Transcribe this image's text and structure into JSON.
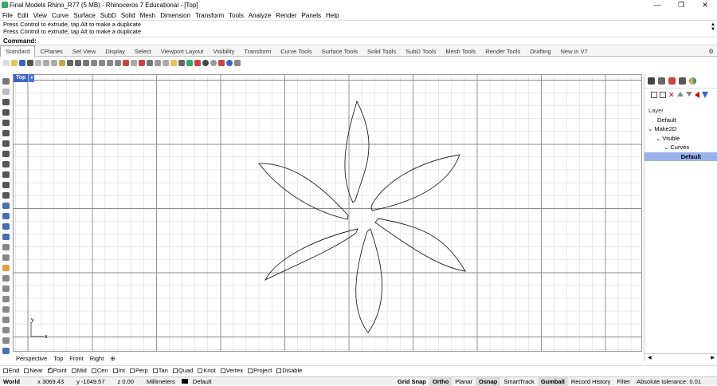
{
  "window": {
    "title": "Final Models Rhino_R77 (5 MB) - Rhinoceros 7 Educational - [Top]",
    "min": "—",
    "restore": "❐",
    "close": "✕"
  },
  "menu": [
    "File",
    "Edit",
    "View",
    "Curve",
    "Surface",
    "SubD",
    "Solid",
    "Mesh",
    "Dimension",
    "Transform",
    "Tools",
    "Analyze",
    "Render",
    "Panels",
    "Help"
  ],
  "command": {
    "history": [
      "Press Control to extrude, tap Alt to make a duplicate",
      "Press Control to extrude, tap Alt to make a duplicate"
    ],
    "prompt": "Command:"
  },
  "tabs": {
    "items": [
      "Standard",
      "CPlanes",
      "Set View",
      "Display",
      "Select",
      "Viewport Layout",
      "Visibility",
      "Transform",
      "Curve Tools",
      "Surface Tools",
      "Solid Tools",
      "SubD Tools",
      "Mesh Tools",
      "Render Tools",
      "Drafting",
      "New in V7"
    ],
    "active": 0
  },
  "viewport": {
    "name": "Top",
    "axis_x": "x",
    "axis_y": "y"
  },
  "layers": {
    "header": "Layer",
    "items": [
      {
        "label": "Default",
        "indent": 0,
        "expander": ""
      },
      {
        "label": "Make2D",
        "indent": 0,
        "expander": "⌄"
      },
      {
        "label": "Visible",
        "indent": 1,
        "expander": "⌄"
      },
      {
        "label": "Curves",
        "indent": 2,
        "expander": "⌄"
      },
      {
        "label": "Default",
        "indent": 3,
        "expander": "",
        "selected": true
      }
    ]
  },
  "view_tabs": [
    "Perspective",
    "Top",
    "Front",
    "Right",
    "⊕"
  ],
  "osnaps": [
    {
      "label": "End",
      "on": false
    },
    {
      "label": "Near",
      "on": false
    },
    {
      "label": "Point",
      "on": true
    },
    {
      "label": "Mid",
      "on": false
    },
    {
      "label": "Cen",
      "on": false
    },
    {
      "label": "Int",
      "on": false
    },
    {
      "label": "Perp",
      "on": false
    },
    {
      "label": "Tan",
      "on": false
    },
    {
      "label": "Quad",
      "on": false
    },
    {
      "label": "Knot",
      "on": false
    },
    {
      "label": "Vertex",
      "on": false
    },
    {
      "label": "Project",
      "on": false
    },
    {
      "label": "Disable",
      "on": false
    }
  ],
  "status": {
    "cplane": "World",
    "x": "x 3069.43",
    "y": "y -1049.57",
    "z": "z 0.00",
    "units": "Millimeters",
    "layer": "Default",
    "toggles": [
      {
        "label": "Grid Snap",
        "on": true
      },
      {
        "label": "Ortho",
        "on": true
      },
      {
        "label": "Planar",
        "on": false
      },
      {
        "label": "Osnap",
        "on": true
      },
      {
        "label": "SmartTrack",
        "on": false
      },
      {
        "label": "Gumball",
        "on": true
      },
      {
        "label": "Record History",
        "on": false
      },
      {
        "label": "Filter",
        "on": false
      }
    ],
    "tolerance": "Absolute tolerance: 0.01"
  },
  "colors": {
    "viewport_label": "#3b62c9",
    "selected_layer": "#9ab2ea",
    "grid": "#c8c8c8",
    "grid_major": "#8a8a8a"
  }
}
